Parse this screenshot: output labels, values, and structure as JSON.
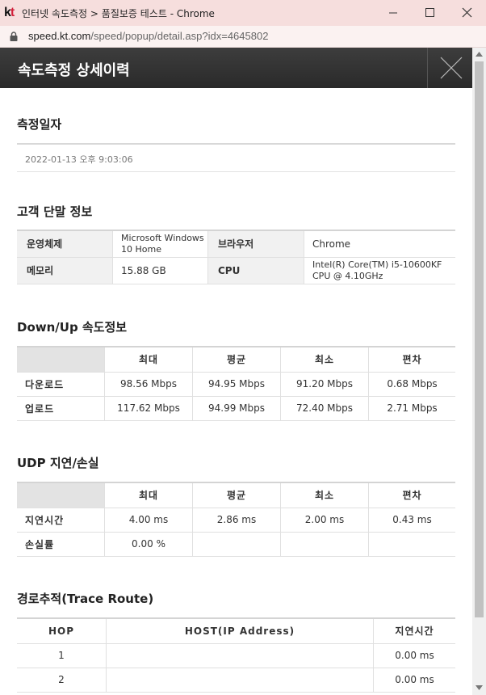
{
  "window": {
    "logo": "kt",
    "title": "인터넷 속도측정 > 품질보증 테스트 - Chrome",
    "url_host": "speed.kt.com",
    "url_path": "/speed/popup/detail.asp?idx=4645802"
  },
  "popup": {
    "title": "속도측정 상세이력"
  },
  "measure_date": {
    "heading": "측정일자",
    "value": "2022-01-13 오후 9:03:06"
  },
  "device": {
    "heading": "고객 단말 정보",
    "os_label": "운영체제",
    "os_value_1": "Microsoft Windows",
    "os_value_2": "10 Home",
    "browser_label": "브라우저",
    "browser_value": "Chrome",
    "memory_label": "메모리",
    "memory_value": "15.88 GB",
    "cpu_label": "CPU",
    "cpu_value_1": "Intel(R) Core(TM) i5-10600KF",
    "cpu_value_2": "CPU @ 4.10GHz"
  },
  "speed": {
    "heading": "Down/Up 속도정보",
    "columns": [
      "최대",
      "평균",
      "최소",
      "편차"
    ],
    "rows": [
      {
        "label": "다운로드",
        "values": [
          "98.56 Mbps",
          "94.95 Mbps",
          "91.20 Mbps",
          "0.68 Mbps"
        ]
      },
      {
        "label": "업로드",
        "values": [
          "117.62 Mbps",
          "94.99 Mbps",
          "72.40 Mbps",
          "2.71 Mbps"
        ]
      }
    ]
  },
  "udp": {
    "heading": "UDP 지연/손실",
    "columns": [
      "최대",
      "평균",
      "최소",
      "편차"
    ],
    "rows": [
      {
        "label": "지연시간",
        "values": [
          "4.00 ms",
          "2.86 ms",
          "2.00 ms",
          "0.43 ms"
        ]
      },
      {
        "label": "손실률",
        "values": [
          "0.00 %",
          "",
          "",
          ""
        ]
      }
    ]
  },
  "trace": {
    "heading": "경로추적(Trace Route)",
    "columns": [
      "HOP",
      "HOST(IP Address)",
      "지연시간"
    ],
    "rows": [
      {
        "hop": "1",
        "host": "",
        "latency": "0.00 ms"
      },
      {
        "hop": "2",
        "host": "",
        "latency": "0.00 ms"
      }
    ]
  }
}
